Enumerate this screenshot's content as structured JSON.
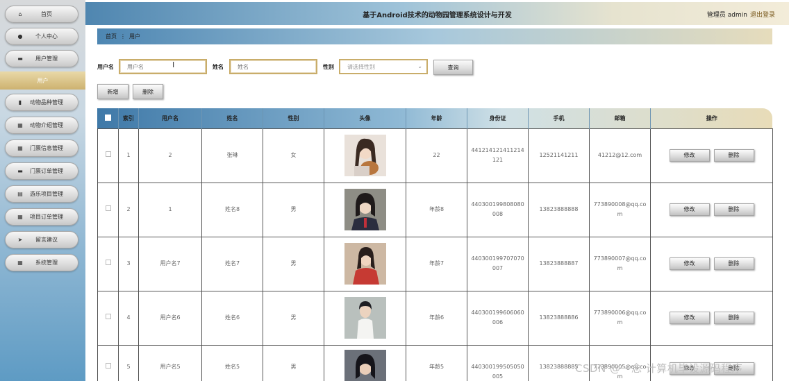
{
  "header": {
    "title": "基于Android技术的动物园管理系统设计与开发",
    "user": "管理员 admin",
    "logout": "退出登录"
  },
  "sidebar": {
    "items": [
      {
        "icon": "home-icon",
        "glyph": "⌂",
        "label": "首页"
      },
      {
        "icon": "user-icon",
        "glyph": "●",
        "label": "个人中心"
      },
      {
        "icon": "users-icon",
        "glyph": "▬",
        "label": "用户管理"
      },
      {
        "icon": "chart-icon",
        "glyph": "▮",
        "label": "动物品种管理"
      },
      {
        "icon": "grid-icon",
        "glyph": "▦",
        "label": "动物介绍管理"
      },
      {
        "icon": "grid-icon",
        "glyph": "▦",
        "label": "门票信息管理"
      },
      {
        "icon": "ticket-icon",
        "glyph": "▬",
        "label": "门票订单管理"
      },
      {
        "icon": "doc-icon",
        "glyph": "▤",
        "label": "游乐项目管理"
      },
      {
        "icon": "grid-icon",
        "glyph": "▦",
        "label": "项目订单管理"
      },
      {
        "icon": "send-icon",
        "glyph": "➤",
        "label": "留言建议"
      },
      {
        "icon": "grid-icon",
        "glyph": "▦",
        "label": "系统管理"
      }
    ],
    "active_sub": "用户"
  },
  "breadcrumb": {
    "home": "首页",
    "sep": "⋮",
    "current": "用户"
  },
  "search": {
    "username_label": "用户名",
    "username_placeholder": "用户名",
    "name_label": "姓名",
    "name_placeholder": "姓名",
    "gender_label": "性别",
    "gender_placeholder": "请选择性别",
    "query_button": "查询"
  },
  "actions": {
    "add": "新增",
    "delete": "删除"
  },
  "table": {
    "columns": [
      "索引",
      "用户名",
      "姓名",
      "性别",
      "头像",
      "年龄",
      "身份证",
      "手机",
      "邮箱",
      "操作"
    ],
    "edit_label": "修改",
    "delete_label": "删除",
    "rows": [
      {
        "index": "1",
        "username": "2",
        "name": "张琳",
        "gender": "女",
        "age": "22",
        "id_card": "441214121411214121",
        "phone": "12521141211",
        "email": "41212@12.com",
        "avatar_color": "#c9a58c"
      },
      {
        "index": "2",
        "username": "1",
        "name": "姓名8",
        "gender": "男",
        "age": "年龄8",
        "id_card": "440300199808080008",
        "phone": "13823888888",
        "email": "773890008@qq.com",
        "avatar_color": "#4a4340"
      },
      {
        "index": "3",
        "username": "用户名7",
        "name": "姓名7",
        "gender": "男",
        "age": "年龄7",
        "id_card": "440300199707070007",
        "phone": "13823888887",
        "email": "773890007@qq.com",
        "avatar_color": "#b8433b"
      },
      {
        "index": "4",
        "username": "用户名6",
        "name": "姓名6",
        "gender": "男",
        "age": "年龄6",
        "id_card": "440300199606060006",
        "phone": "13823888886",
        "email": "773890006@qq.com",
        "avatar_color": "#8f9a99"
      },
      {
        "index": "5",
        "username": "用户名5",
        "name": "姓名5",
        "gender": "男",
        "age": "年龄5",
        "id_card": "440300199505050005",
        "phone": "13823888885",
        "email": "773890005@qq.com",
        "avatar_color": "#3d3a3d"
      }
    ]
  },
  "watermark": "CSDN @一念 计算机毕设源码程序"
}
